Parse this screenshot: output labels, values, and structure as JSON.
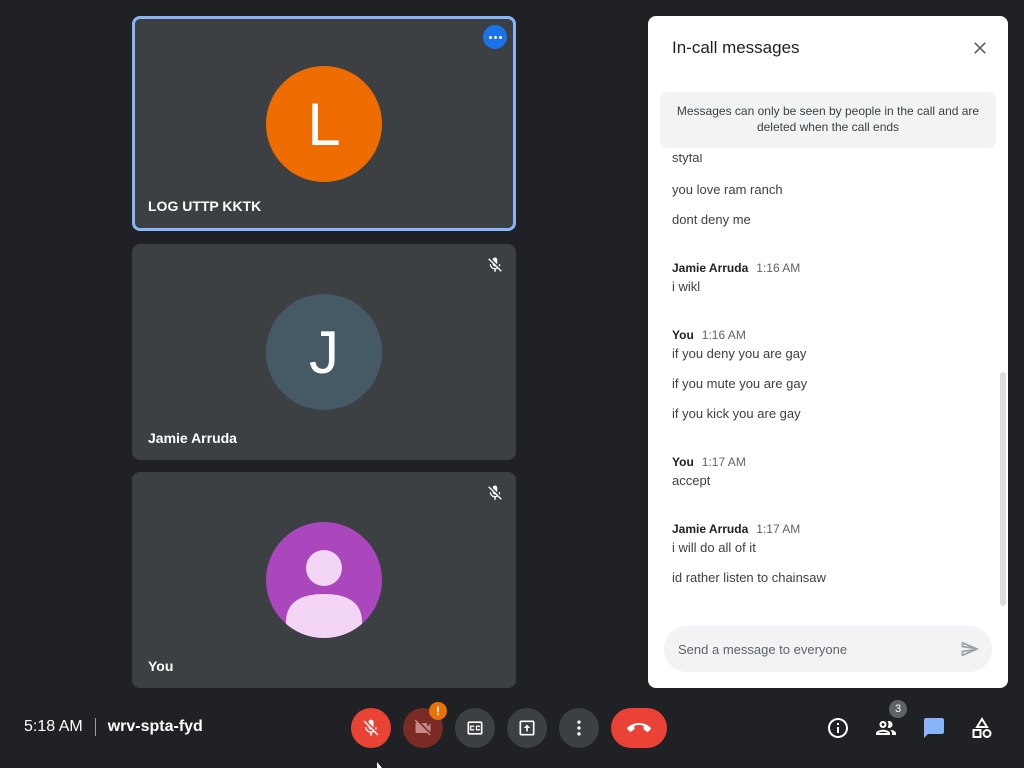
{
  "participants": [
    {
      "initial": "L",
      "name": "LOG UTTP KKTK",
      "avatar_color": "#ef6c00"
    },
    {
      "initial": "J",
      "name": "Jamie Arruda",
      "avatar_color": "#455a64"
    },
    {
      "initial": "",
      "name": "You",
      "avatar_color": "#ab47bc"
    }
  ],
  "chat": {
    "title": "In-call messages",
    "notice": "Messages can only be seen by people in the call and are deleted when the call ends",
    "messages": [
      {
        "text": "styfal"
      },
      {
        "text": "you love ram ranch"
      },
      {
        "text": "dont deny me"
      },
      {
        "sender": "Jamie Arruda",
        "time": "1:16 AM"
      },
      {
        "text": "i wikl"
      },
      {
        "sender": "You",
        "time": "1:16 AM"
      },
      {
        "text": "if you deny you are gay"
      },
      {
        "text": "if you mute you are gay"
      },
      {
        "text": "if you kick you are gay"
      },
      {
        "sender": "You",
        "time": "1:17 AM"
      },
      {
        "text": "accept"
      },
      {
        "sender": "Jamie Arruda",
        "time": "1:17 AM"
      },
      {
        "text": "i will do all of it"
      },
      {
        "text": "id rather listen to chainsaw"
      }
    ],
    "input_placeholder": "Send a message to everyone"
  },
  "meeting": {
    "time": "5:18 AM",
    "code": "wrv-spta-fyd"
  },
  "controls": {
    "camera_warning": "!",
    "people_count": "3"
  },
  "colors": {
    "accent": "#1a73e8",
    "danger": "#ea4335",
    "warning": "#e8710a"
  }
}
